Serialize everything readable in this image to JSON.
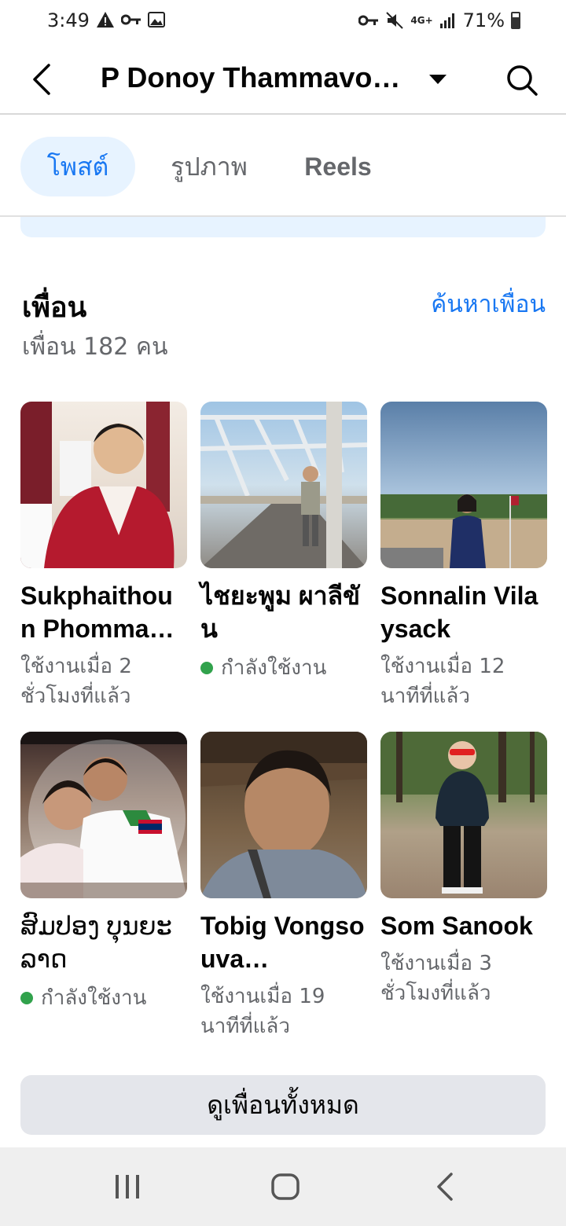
{
  "status_bar": {
    "time": "3:49",
    "network": "4G+",
    "battery": "71%"
  },
  "header": {
    "title": "P Donoy Thammavo…"
  },
  "tabs": [
    {
      "label": "โพสต์",
      "active": true
    },
    {
      "label": "รูปภาพ",
      "active": false
    },
    {
      "label": "Reels",
      "active": false
    }
  ],
  "friends": {
    "heading": "เพื่อน",
    "find_link": "ค้นหาเพื่อน",
    "count_text": "เพื่อน 182 คน",
    "items": [
      {
        "name": "Sukphaithoun Phomma…",
        "status": "ใช้งานเมื่อ 2 ชั่วโมงที่แล้ว",
        "online": false
      },
      {
        "name": "ไชยะพูม ผาลีขัน",
        "status": "กำลังใช้งาน",
        "online": true
      },
      {
        "name": "Sonnalin Vilaysack",
        "status": "ใช้งานเมื่อ 12 นาทีที่แล้ว",
        "online": false
      },
      {
        "name": "ສົມປອງ ບຸນຍະລາດ",
        "status": "กำลังใช้งาน",
        "online": true
      },
      {
        "name": "Tobig Vongsouva…",
        "status": "ใช้งานเมื่อ 19 นาทีที่แล้ว",
        "online": false
      },
      {
        "name": "Som Sanook",
        "status": "ใช้งานเมื่อ 3 ชั่วโมงที่แล้ว",
        "online": false
      }
    ],
    "see_all": "ดูเพื่อนทั้งหมด"
  },
  "colors": {
    "accent": "#1877f2",
    "online": "#31a24c",
    "secondary_text": "#65676b"
  }
}
